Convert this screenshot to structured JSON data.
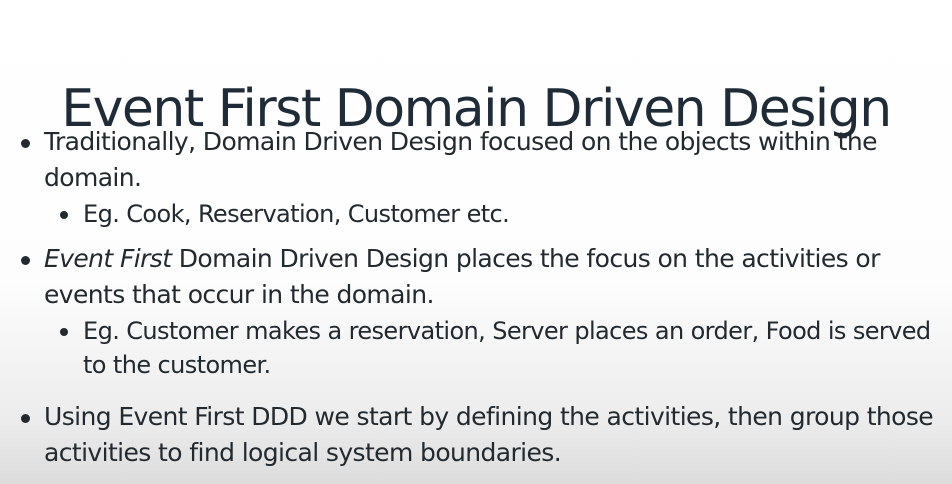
{
  "slide": {
    "title": "Event First Domain Driven Design",
    "bullets": [
      {
        "text": "Traditionally, Domain Driven Design focused on the objects within the domain."
      },
      {
        "text": "Eg. Cook, Reservation, Customer etc."
      },
      {
        "emphasis": "Event First",
        "text": " Domain Driven Design places the focus on the activities or events that occur in the domain."
      },
      {
        "text": "Eg. Customer makes a reservation, Server places an order, Food is served to the customer."
      },
      {
        "text": "Using Event First DDD we start by defining the activities, then group those activities to find logical system boundaries."
      }
    ]
  }
}
